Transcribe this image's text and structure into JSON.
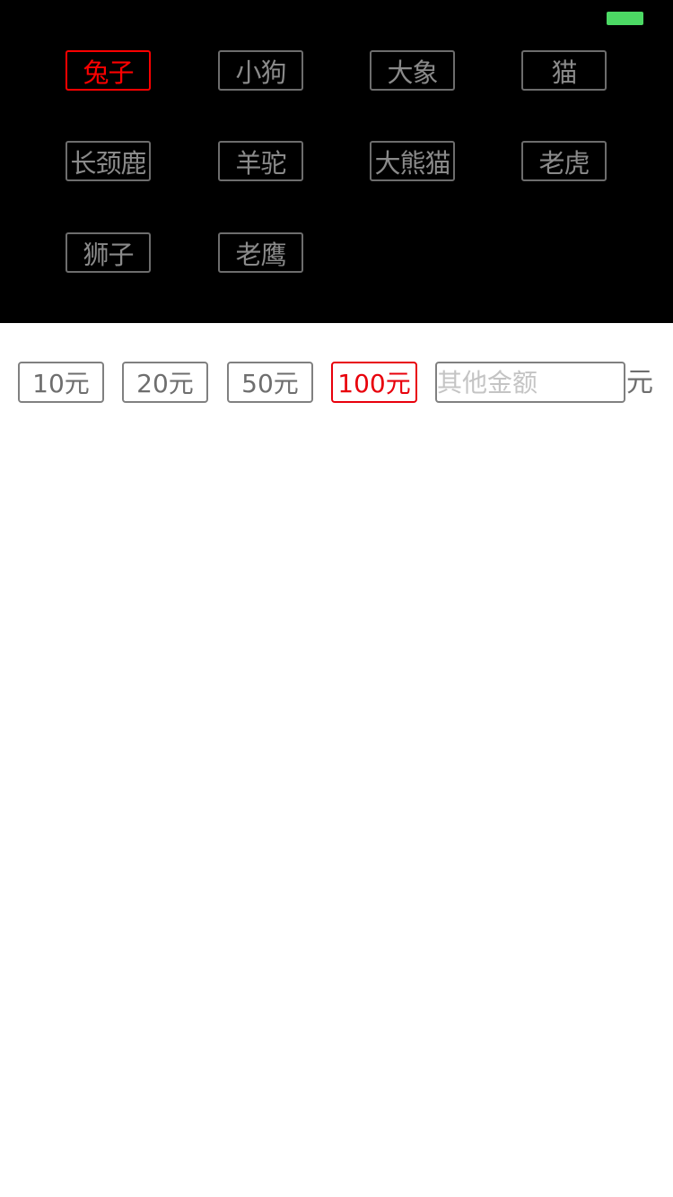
{
  "colors": {
    "panel_background": "#000000",
    "page_background": "#ffffff",
    "tag_border": "#6d6d6d",
    "tag_text": "#8a8a8a",
    "selected": "#ff0000",
    "battery": "#4cd964"
  },
  "status_bar": {
    "battery_icon": "battery-full-icon"
  },
  "animal_tags": {
    "selected_label": "兔子",
    "items": [
      {
        "label": "兔子",
        "selected": true
      },
      {
        "label": "小狗",
        "selected": false
      },
      {
        "label": "大象",
        "selected": false
      },
      {
        "label": "猫",
        "selected": false
      },
      {
        "label": "长颈鹿",
        "selected": false
      },
      {
        "label": "羊驼",
        "selected": false
      },
      {
        "label": "大熊猫",
        "selected": false
      },
      {
        "label": "老虎",
        "selected": false
      },
      {
        "label": "狮子",
        "selected": false
      },
      {
        "label": "老鹰",
        "selected": false
      }
    ]
  },
  "amounts": {
    "options": [
      {
        "label": "10元",
        "selected": false
      },
      {
        "label": "20元",
        "selected": false
      },
      {
        "label": "50元",
        "selected": false
      },
      {
        "label": "100元",
        "selected": true
      }
    ],
    "other": {
      "value": "",
      "placeholder": "其他金额",
      "unit": "元"
    }
  }
}
